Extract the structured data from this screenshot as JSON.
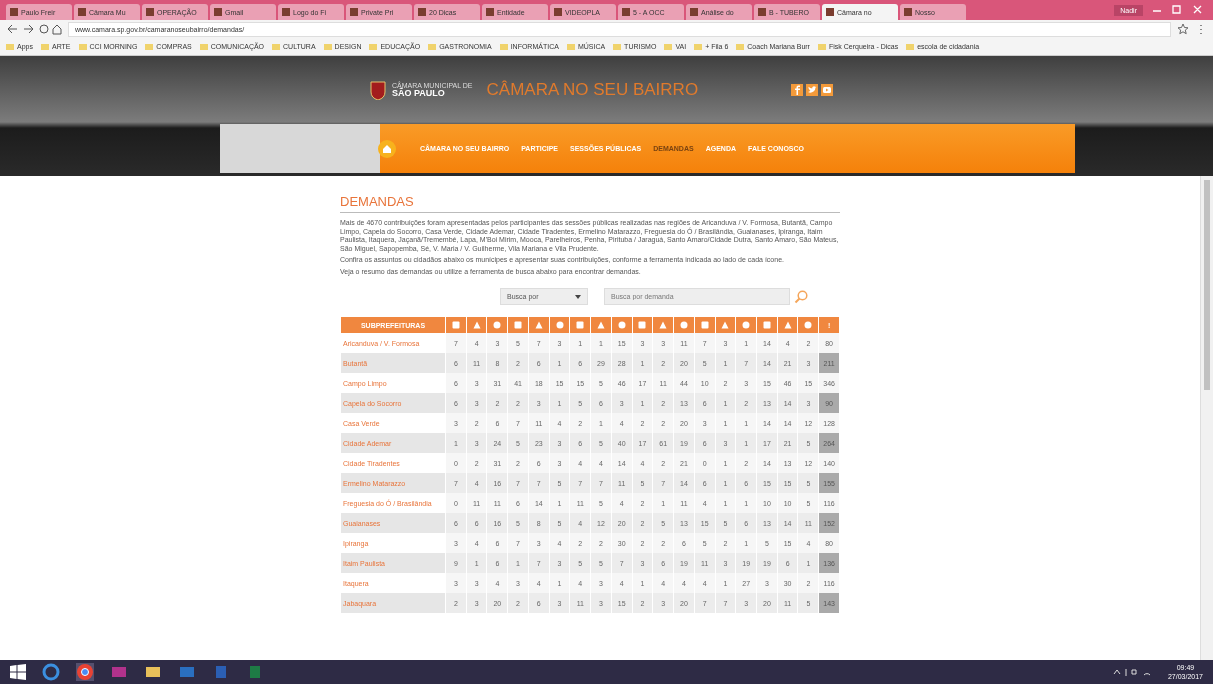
{
  "browser": {
    "tabs": [
      {
        "title": "Paulo Freir",
        "selected": false
      },
      {
        "title": "Câmara Mu",
        "selected": false
      },
      {
        "title": "OPERAÇÃO",
        "selected": false
      },
      {
        "title": "Gmail",
        "selected": false
      },
      {
        "title": "Logo do Fi",
        "selected": false
      },
      {
        "title": "Private Pri",
        "selected": false
      },
      {
        "title": "20 Dicas",
        "selected": false
      },
      {
        "title": "Entidade",
        "selected": false
      },
      {
        "title": "VIDEOPLA",
        "selected": false
      },
      {
        "title": "5 - A OCC",
        "selected": false
      },
      {
        "title": "Análise do",
        "selected": false
      },
      {
        "title": "B - TUBERO",
        "selected": false
      },
      {
        "title": "Câmara no",
        "selected": true
      },
      {
        "title": "Nosso",
        "selected": false
      }
    ],
    "user": "Nadir",
    "url": "www.camara.sp.gov.br/camaranoseubairro/demandas/",
    "bookmarks": [
      "Apps",
      "ARTE",
      "CCI MORNING",
      "COMPRAS",
      "COMUNICAÇÃO",
      "CULTURA",
      "DESIGN",
      "EDUCAÇÃO",
      "GASTRONOMIA",
      "INFORMÁTICA",
      "MÚSICA",
      "TURISMO",
      "VAI",
      "+ Fila 6",
      "Coach Mariana Burr",
      "Fisk Cerqueira - Dicas",
      "escola de cidadania"
    ]
  },
  "header": {
    "logo_top": "CÂMARA MUNICIPAL DE",
    "logo_bottom": "SÃO PAULO",
    "title": "CÂMARA NO SEU BAIRRO"
  },
  "nav": [
    {
      "label": "CÂMARA NO SEU BAIRRO",
      "selected": false
    },
    {
      "label": "PARTICIPE",
      "selected": false
    },
    {
      "label": "SESSÕES PÚBLICAS",
      "selected": false
    },
    {
      "label": "DEMANDAS",
      "selected": true
    },
    {
      "label": "AGENDA",
      "selected": false
    },
    {
      "label": "FALE CONOSCO",
      "selected": false
    }
  ],
  "content": {
    "title": "DEMANDAS",
    "paragraphs": [
      "Mais de 4670 contribuições foram apresentadas pelos participantes das sessões públicas realizadas nas regiões de Aricanduva / V. Formosa, Butantã, Campo Limpo, Capela do Socorro, Casa Verde, Cidade Ademar, Cidade Tiradentes, Ermelino Matarazzo, Freguesia do Ó / Brasilândia, Guaianases, Ipiranga, Itaim Paulista, Itaquera, Jaçanã/Tremembé, Lapa, M'Boi Mirim, Mooca, Parelheiros, Penha, Pirituba / Jaraguá, Santo Amaro/Cidade Dutra, Santo Amaro, São Mateus, São Miguel, Sapopemba, Sé, V. Maria / V. Guilherme, Vila Mariana e Vila Prudente.",
      "Confira os assuntos ou cidadãos abaixo os munícipes e apresentar suas contribuições, conforme a ferramenta indicada ao lado de cada ícone.",
      "Veja o resumo das demandas ou utilize a ferramenta de busca abaixo para encontrar demandas."
    ],
    "select": "Busca por",
    "search": {
      "placeholder": "Busca por demanda"
    }
  },
  "table": {
    "first_column": "SUBPREFEITURAS",
    "last_column": "!",
    "rows": [
      {
        "name": "Aricanduva / V. Formosa",
        "values": [
          "7",
          "4",
          "3",
          "5",
          "7",
          "3",
          "1",
          "1",
          "15",
          "3",
          "3",
          "11",
          "7",
          "3",
          "1",
          "14",
          "4",
          "2",
          "80"
        ]
      },
      {
        "name": "Butantã",
        "values": [
          "6",
          "11",
          "8",
          "2",
          "6",
          "1",
          "6",
          "29",
          "28",
          "1",
          "2",
          "20",
          "5",
          "1",
          "7",
          "14",
          "21",
          "3",
          "211"
        ]
      },
      {
        "name": "Campo Limpo",
        "values": [
          "6",
          "3",
          "31",
          "41",
          "18",
          "15",
          "15",
          "5",
          "46",
          "17",
          "11",
          "44",
          "10",
          "2",
          "3",
          "15",
          "46",
          "15",
          "346"
        ]
      },
      {
        "name": "Capela do Socorro",
        "values": [
          "6",
          "3",
          "2",
          "2",
          "3",
          "1",
          "5",
          "6",
          "3",
          "1",
          "2",
          "13",
          "6",
          "1",
          "2",
          "13",
          "14",
          "3",
          "90"
        ]
      },
      {
        "name": "Casa Verde",
        "values": [
          "3",
          "2",
          "6",
          "7",
          "11",
          "4",
          "2",
          "1",
          "4",
          "2",
          "2",
          "20",
          "3",
          "1",
          "1",
          "14",
          "14",
          "12",
          "128"
        ]
      },
      {
        "name": "Cidade Ademar",
        "values": [
          "1",
          "3",
          "24",
          "5",
          "23",
          "3",
          "6",
          "5",
          "40",
          "17",
          "61",
          "19",
          "6",
          "3",
          "1",
          "17",
          "21",
          "5",
          "264"
        ]
      },
      {
        "name": "Cidade Tiradentes",
        "values": [
          "0",
          "2",
          "31",
          "2",
          "6",
          "3",
          "4",
          "4",
          "14",
          "4",
          "2",
          "21",
          "0",
          "1",
          "2",
          "14",
          "13",
          "12",
          "140"
        ]
      },
      {
        "name": "Ermelino Matarazzo",
        "values": [
          "7",
          "4",
          "16",
          "7",
          "7",
          "5",
          "7",
          "7",
          "11",
          "5",
          "7",
          "14",
          "6",
          "1",
          "6",
          "15",
          "15",
          "5",
          "155"
        ]
      },
      {
        "name": "Freguesia do Ó / Brasilândia",
        "values": [
          "0",
          "11",
          "11",
          "6",
          "14",
          "1",
          "11",
          "5",
          "4",
          "2",
          "1",
          "11",
          "4",
          "1",
          "1",
          "10",
          "10",
          "5",
          "116"
        ]
      },
      {
        "name": "Guaianases",
        "values": [
          "6",
          "6",
          "16",
          "5",
          "8",
          "5",
          "4",
          "12",
          "20",
          "2",
          "5",
          "13",
          "15",
          "5",
          "6",
          "13",
          "14",
          "11",
          "152"
        ]
      },
      {
        "name": "Ipiranga",
        "values": [
          "3",
          "4",
          "6",
          "7",
          "3",
          "4",
          "2",
          "2",
          "30",
          "2",
          "2",
          "6",
          "5",
          "2",
          "1",
          "5",
          "15",
          "4",
          "80"
        ]
      },
      {
        "name": "Itaim Paulista",
        "values": [
          "9",
          "1",
          "6",
          "1",
          "7",
          "3",
          "5",
          "5",
          "7",
          "3",
          "6",
          "19",
          "11",
          "3",
          "19",
          "19",
          "6",
          "1",
          "136"
        ]
      },
      {
        "name": "Itaquera",
        "values": [
          "3",
          "3",
          "4",
          "3",
          "4",
          "1",
          "4",
          "3",
          "4",
          "1",
          "4",
          "4",
          "4",
          "1",
          "27",
          "3",
          "30",
          "2",
          "116"
        ]
      },
      {
        "name": "Jabaquara",
        "values": [
          "2",
          "3",
          "20",
          "2",
          "6",
          "3",
          "11",
          "3",
          "15",
          "2",
          "3",
          "20",
          "7",
          "7",
          "3",
          "20",
          "11",
          "5",
          "143"
        ]
      }
    ]
  },
  "taskbar": {
    "time": "09:49",
    "date": "27/03/2017"
  }
}
